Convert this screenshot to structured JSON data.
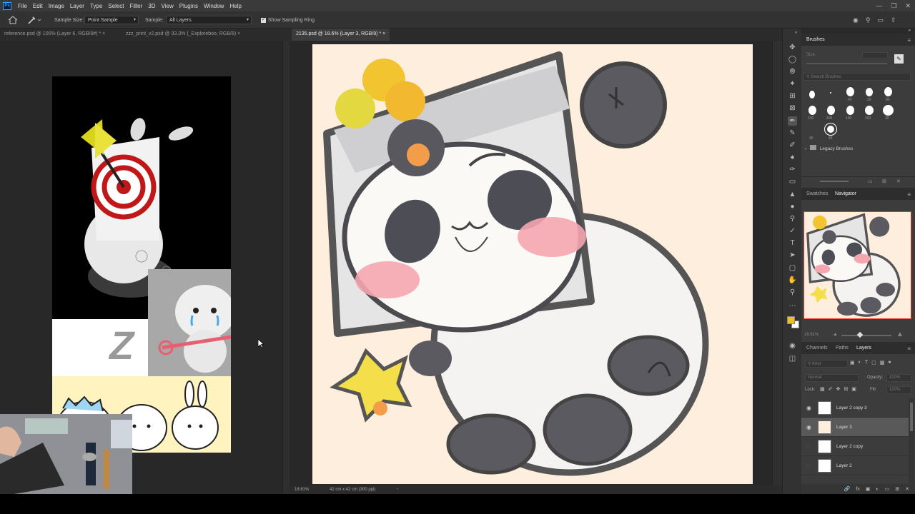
{
  "menu": [
    "File",
    "Edit",
    "Image",
    "Layer",
    "Type",
    "Select",
    "Filter",
    "3D",
    "View",
    "Plugins",
    "Window",
    "Help"
  ],
  "options": {
    "sample_size_label": "Sample Size:",
    "sample_size_value": "Point Sample",
    "sample_label": "Sample:",
    "sample_value": "All Layers",
    "show_ring_label": "Show Sampling Ring"
  },
  "tabs": [
    {
      "label": "reference.psd @ 100% (Layer 6, RGB/8#) *"
    },
    {
      "label": "zzz_print_v2.psd @ 33.3% (_Exploreboo, RGB/8)"
    },
    {
      "label": "2135.psd @ 18.6% (Layer 3, RGB/8) *"
    }
  ],
  "status": {
    "zoom": "18.61%",
    "doc_size": "42 cm x 42 cm (300 ppi)"
  },
  "brushes": {
    "title": "Brushes",
    "size_label": "Size:",
    "search_placeholder": "Search Brushes",
    "sizes": [
      "",
      "",
      "40",
      "20",
      "80",
      "100",
      "400",
      "150",
      "200",
      "30",
      "45",
      "45"
    ],
    "legacy_label": "Legacy Brushes"
  },
  "navigator": {
    "tab_swatches": "Swatches",
    "tab_navigator": "Navigator",
    "zoom": "18.61%"
  },
  "layers_panel": {
    "tab_channels": "Channels",
    "tab_paths": "Paths",
    "tab_layers": "Layers",
    "kind_placeholder": "Kind",
    "blend_mode": "Normal",
    "opacity_label": "Opacity:",
    "opacity_value": "100%",
    "lock_label": "Lock:",
    "fill_label": "Fill:",
    "fill_value": "100%",
    "layers": [
      {
        "name": "Layer 2 copy 3",
        "visible": true,
        "selected": false
      },
      {
        "name": "Layer 3",
        "visible": true,
        "selected": true
      },
      {
        "name": "Layer 2 copy",
        "visible": false,
        "selected": false
      },
      {
        "name": "Layer 2",
        "visible": false,
        "selected": false
      }
    ]
  },
  "colors": {
    "foreground": "#f0c020",
    "background": "#ffffff",
    "canvas_bg": "#fdeedd"
  },
  "reference_text": "Z"
}
